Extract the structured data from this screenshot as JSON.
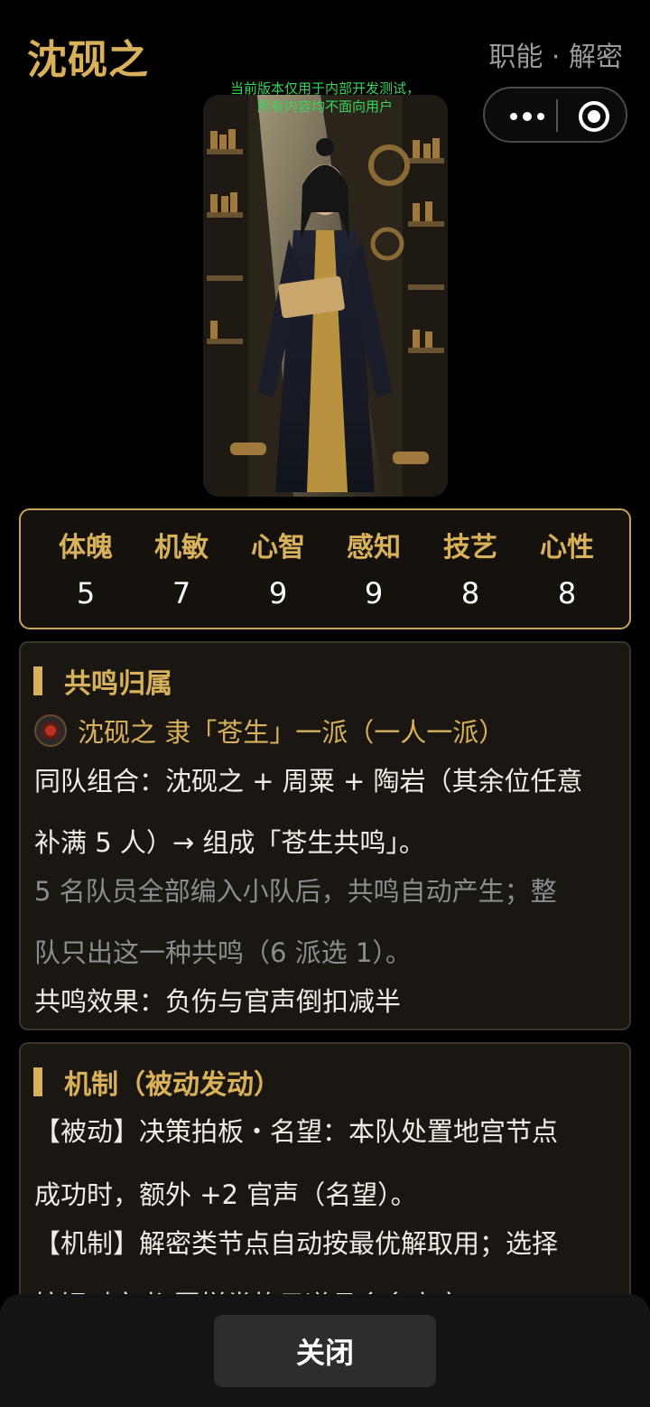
{
  "header": {
    "title": "沈砚之",
    "subtitle": "职能 · 解密"
  },
  "capsule": {
    "more_icon": "more-dots-icon",
    "close_icon": "target-circle-icon"
  },
  "notice": {
    "line1": "当前版本仅用于内部开发测试，",
    "line2": "所有内容均不面向用户"
  },
  "stats": [
    {
      "name": "体魄",
      "value": "5"
    },
    {
      "name": "机敏",
      "value": "7"
    },
    {
      "name": "心智",
      "value": "9"
    },
    {
      "name": "感知",
      "value": "9"
    },
    {
      "name": "技艺",
      "value": "8"
    },
    {
      "name": "心性",
      "value": "8"
    }
  ],
  "resonance": {
    "title": "共鸣归属",
    "faction": "沈砚之 隶「苍生」一派（一人一派）",
    "combo1": "同队组合：沈砚之 + 周粟 + 陶岩（其余位任意",
    "combo2": "补满 5 人）→ 组成「苍生共鸣」。",
    "note1": "5 名队员全部编入小队后，共鸣自动产生；整",
    "note2": "队只出这一种共鸣（6 派选 1）。",
    "effect": "共鸣效果：负伤与官声倒扣减半"
  },
  "mechanism": {
    "title": "机制（被动发动）",
    "p1a": "【被动】决策拍板・名望：本队处置地宫节点",
    "p1b": "成功时，额外 +2 官声（名望）。",
    "p2a": "【机制】解密类节点自动按最优解取用；选择",
    "p2b": "按钮对文书/图样类格子道具会多高亮。"
  },
  "footer": {
    "close_label": "关闭"
  },
  "colors": {
    "gold": "#d9b15a",
    "notice_green": "#37d45a",
    "background": "#000000"
  }
}
